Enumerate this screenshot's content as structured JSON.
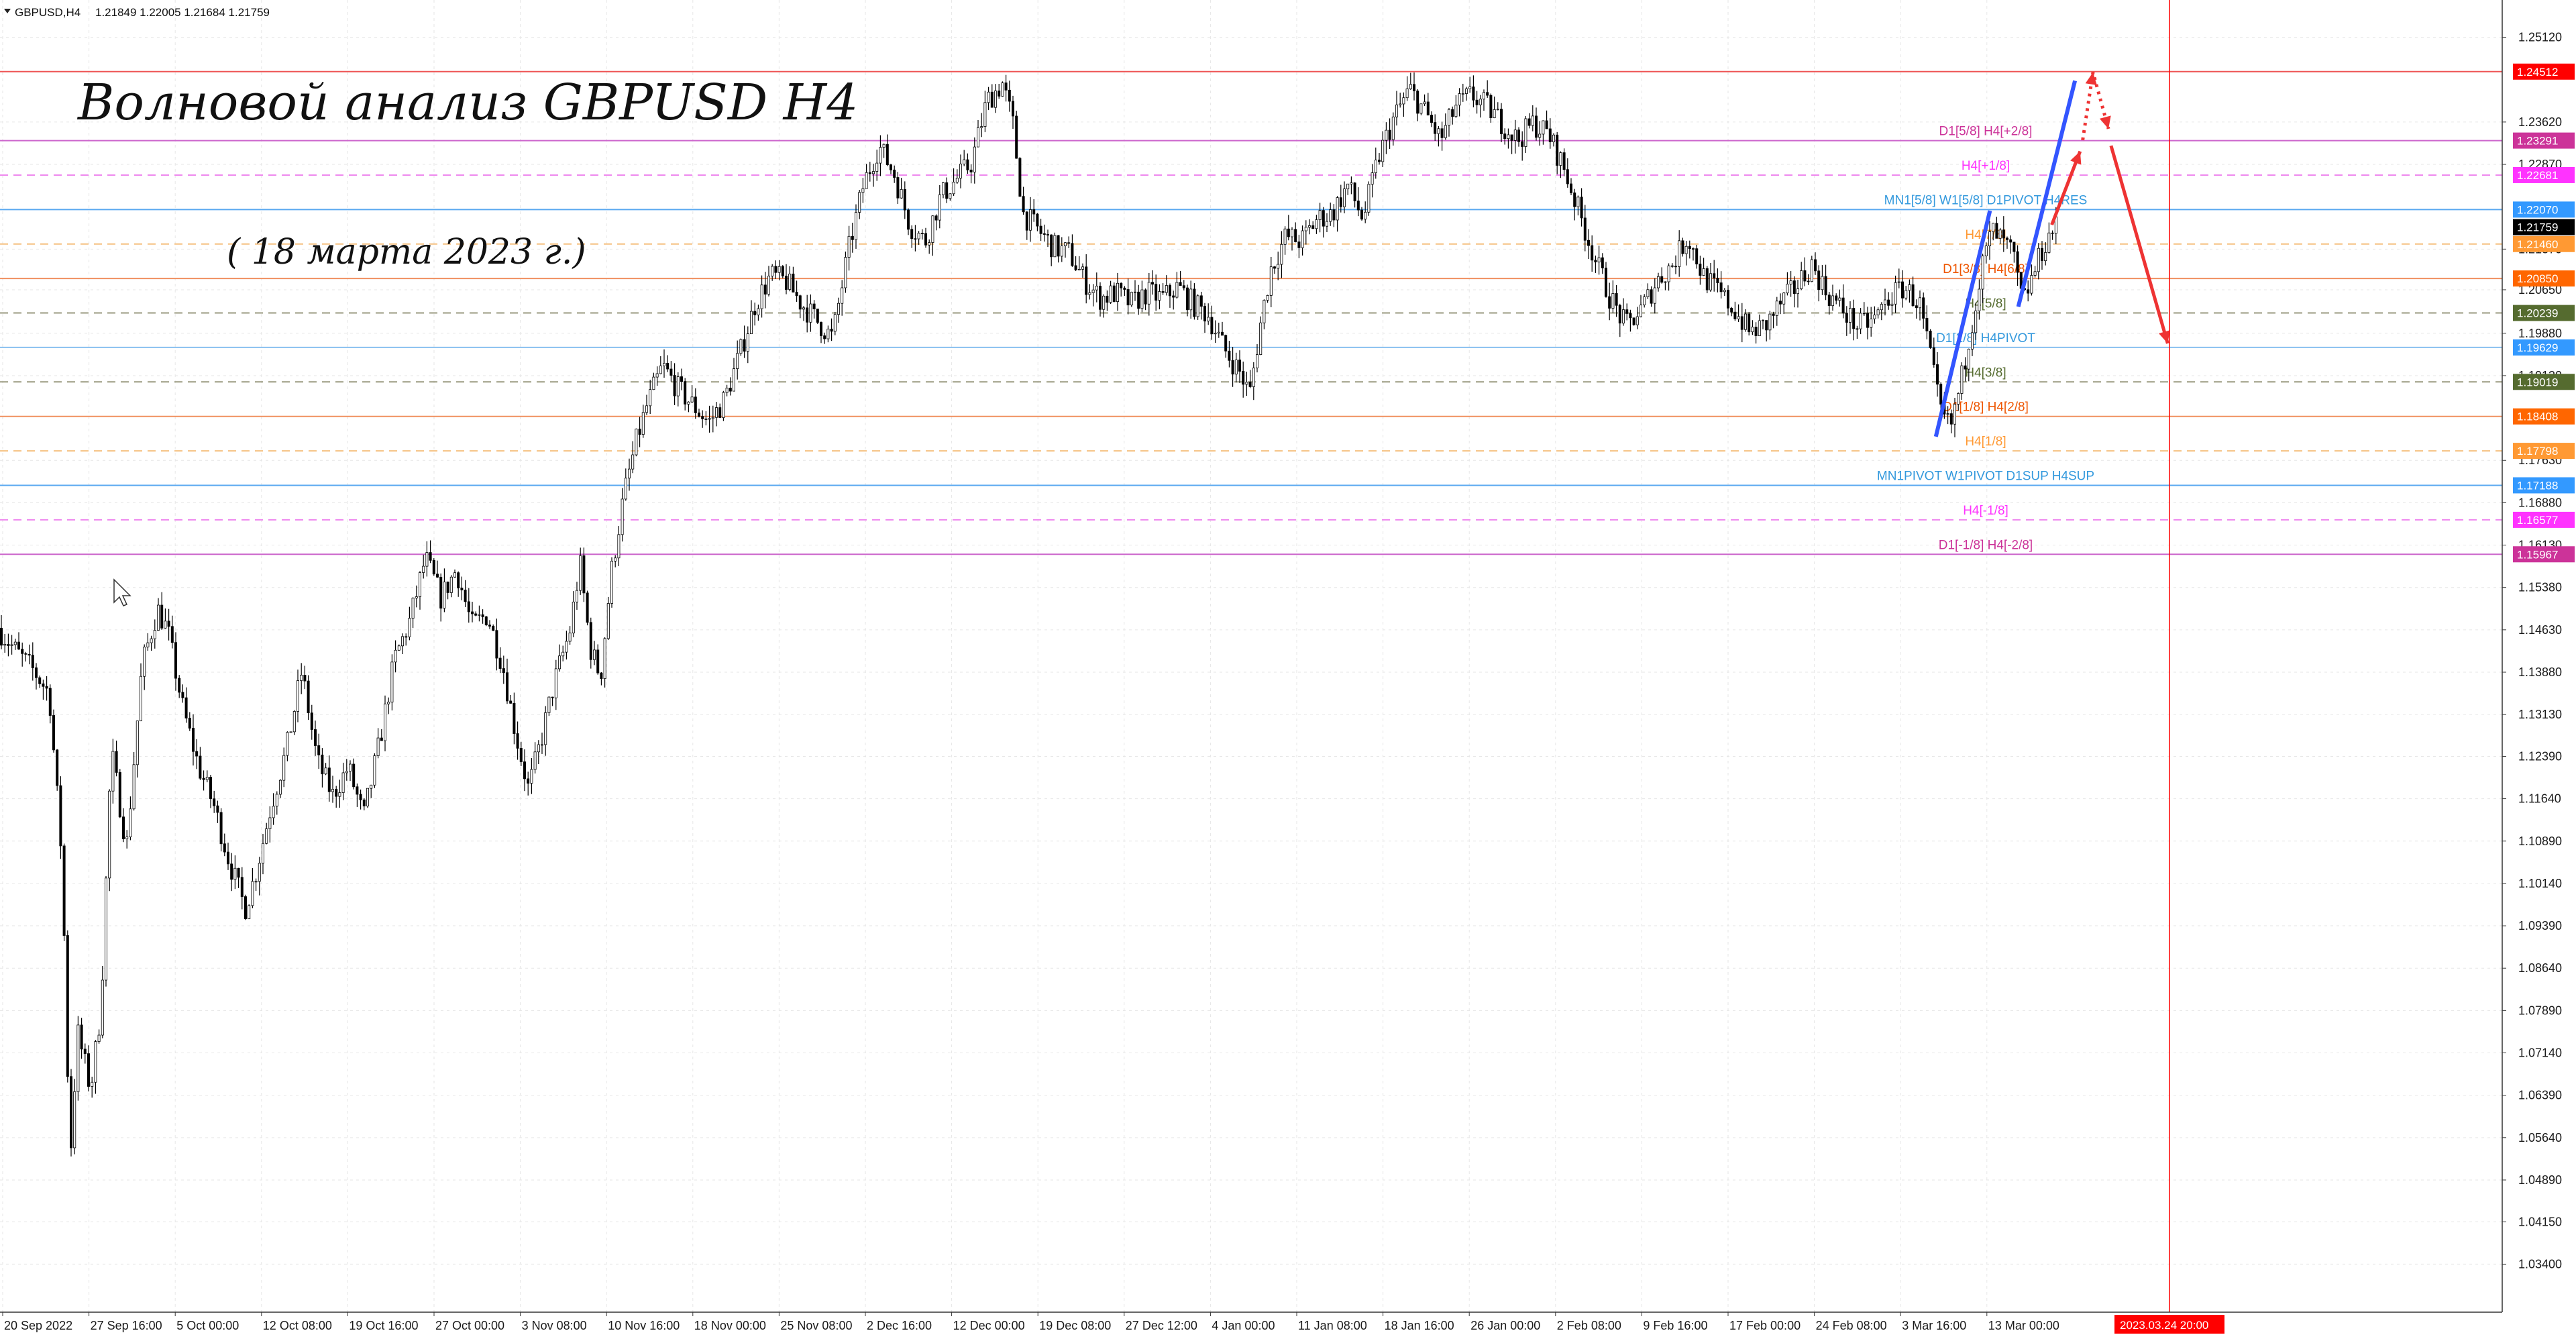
{
  "header": {
    "symbol": "GBPUSD,H4",
    "ohlc": "1.21849 1.22005 1.21684 1.21759"
  },
  "annotations": {
    "title": "Волновой анализ GBPUSD H4",
    "date": "( 18 марта 2023 г.)"
  },
  "price_axis": {
    "min": 1.0255,
    "max": 1.2578,
    "ticks": [
      "1.25120",
      "1.23620",
      "1.22870",
      "1.21370",
      "1.20650",
      "1.19880",
      "1.19130",
      "1.17630",
      "1.16880",
      "1.16130",
      "1.15380",
      "1.14630",
      "1.13880",
      "1.13130",
      "1.12390",
      "1.11640",
      "1.10890",
      "1.10140",
      "1.09390",
      "1.08640",
      "1.07890",
      "1.07140",
      "1.06390",
      "1.05640",
      "1.04890",
      "1.04150",
      "1.03400"
    ]
  },
  "time_axis": {
    "labels": [
      "20 Sep 2022",
      "27 Sep 16:00",
      "5 Oct 00:00",
      "12 Oct 08:00",
      "19 Oct 16:00",
      "27 Oct 00:00",
      "3 Nov 08:00",
      "10 Nov 16:00",
      "18 Nov 00:00",
      "25 Nov 08:00",
      "2 Dec 16:00",
      "12 Dec 00:00",
      "19 Dec 08:00",
      "27 Dec 12:00",
      "4 Jan 00:00",
      "11 Jan 08:00",
      "18 Jan 16:00",
      "26 Jan 00:00",
      "2 Feb 08:00",
      "9 Feb 16:00",
      "17 Feb 00:00",
      "24 Feb 08:00",
      "3 Mar 16:00",
      "13 Mar 00:00"
    ],
    "marker_label": "2023.03.24 20:00"
  },
  "levels": [
    {
      "price": 1.24512,
      "tag": "1.24512",
      "tag_color": "#ff0000",
      "line_color": "#ee5555",
      "style": "solid",
      "label": ""
    },
    {
      "price": 1.23291,
      "tag": "1.23291",
      "tag_color": "#cc3399",
      "line_color": "#cc66cc",
      "style": "solid",
      "label": "D1[5/8] H4[+2/8]",
      "label_color": "#cc3399"
    },
    {
      "price": 1.22681,
      "tag": "1.22681",
      "tag_color": "#ff33ff",
      "line_color": "#ee88ee",
      "style": "dash",
      "label": "H4[+1/8]",
      "label_color": "#ff33ff"
    },
    {
      "price": 1.2207,
      "tag": "1.22070",
      "tag_color": "#3399ff",
      "line_color": "#5aa8f0",
      "style": "solid",
      "label": "MN1[5/8] W1[5/8] D1PIVOT H4RES",
      "label_color": "#3399dd"
    },
    {
      "price": 1.2146,
      "tag": "1.21460",
      "tag_color": "#ff9933",
      "line_color": "#f5c080",
      "style": "dash",
      "label": "H4[7/8]",
      "label_color": "#ff9933"
    },
    {
      "price": 1.2085,
      "tag": "1.20850",
      "tag_color": "#ff6600",
      "line_color": "#f09060",
      "style": "solid",
      "label": "D1[3/8] H4[6/8]",
      "label_color": "#ee5500"
    },
    {
      "price": 1.20239,
      "tag": "1.20239",
      "tag_color": "#556b2f",
      "line_color": "#9a9a80",
      "style": "dash",
      "label": "H4[5/8]",
      "label_color": "#556b2f"
    },
    {
      "price": 1.19629,
      "tag": "1.19629",
      "tag_color": "#3399ff",
      "line_color": "#88c0f0",
      "style": "solid",
      "label": "D1[2/8] H4PIVOT",
      "label_color": "#3399dd"
    },
    {
      "price": 1.19019,
      "tag": "1.19019",
      "tag_color": "#556b2f",
      "line_color": "#9a9a80",
      "style": "dash",
      "label": "H4[3/8]",
      "label_color": "#556b2f"
    },
    {
      "price": 1.18408,
      "tag": "1.18408",
      "tag_color": "#ff6600",
      "line_color": "#f09060",
      "style": "solid",
      "label": "D1[1/8] H4[2/8]",
      "label_color": "#ee5500"
    },
    {
      "price": 1.17798,
      "tag": "1.17798",
      "tag_color": "#ff9933",
      "line_color": "#f5c080",
      "style": "dash",
      "label": "H4[1/8]",
      "label_color": "#ff9933"
    },
    {
      "price": 1.17188,
      "tag": "1.17188",
      "tag_color": "#3399ff",
      "line_color": "#5aa8f0",
      "style": "solid",
      "label": "MN1PIVOT W1PIVOT D1SUP H4SUP",
      "label_color": "#3399dd"
    },
    {
      "price": 1.16577,
      "tag": "1.16577",
      "tag_color": "#ff33ff",
      "line_color": "#ee88ee",
      "style": "dash",
      "label": "H4[-1/8]",
      "label_color": "#ff33ff"
    },
    {
      "price": 1.15967,
      "tag": "1.15967",
      "tag_color": "#cc3399",
      "line_color": "#cc66cc",
      "style": "solid",
      "label": "D1[-1/8] H4[-2/8]",
      "label_color": "#cc3399"
    }
  ],
  "current_price": {
    "price": 1.21759,
    "tag": "1.21759"
  },
  "chart_data": {
    "type": "candlestick",
    "series_path": [
      [
        0.0,
        1.1466
      ],
      [
        0.008,
        1.142
      ],
      [
        0.014,
        1.139
      ],
      [
        0.02,
        1.135
      ],
      [
        0.025,
        1.105
      ],
      [
        0.028,
        1.052
      ],
      [
        0.031,
        1.075
      ],
      [
        0.036,
        1.065
      ],
      [
        0.04,
        1.079
      ],
      [
        0.044,
        1.125
      ],
      [
        0.05,
        1.108
      ],
      [
        0.056,
        1.14
      ],
      [
        0.062,
        1.15
      ],
      [
        0.066,
        1.146
      ],
      [
        0.072,
        1.132
      ],
      [
        0.078,
        1.122
      ],
      [
        0.084,
        1.115
      ],
      [
        0.09,
        1.105
      ],
      [
        0.096,
        1.097
      ],
      [
        0.1,
        1.103
      ],
      [
        0.106,
        1.115
      ],
      [
        0.112,
        1.125
      ],
      [
        0.118,
        1.139
      ],
      [
        0.124,
        1.123
      ],
      [
        0.13,
        1.117
      ],
      [
        0.136,
        1.122
      ],
      [
        0.142,
        1.113
      ],
      [
        0.148,
        1.126
      ],
      [
        0.154,
        1.141
      ],
      [
        0.16,
        1.148
      ],
      [
        0.166,
        1.159
      ],
      [
        0.172,
        1.152
      ],
      [
        0.178,
        1.157
      ],
      [
        0.184,
        1.147
      ],
      [
        0.19,
        1.149
      ],
      [
        0.196,
        1.14
      ],
      [
        0.201,
        1.128
      ],
      [
        0.206,
        1.118
      ],
      [
        0.211,
        1.127
      ],
      [
        0.216,
        1.137
      ],
      [
        0.222,
        1.146
      ],
      [
        0.226,
        1.158
      ],
      [
        0.23,
        1.143
      ],
      [
        0.234,
        1.138
      ],
      [
        0.238,
        1.156
      ],
      [
        0.243,
        1.17
      ],
      [
        0.248,
        1.18
      ],
      [
        0.252,
        1.186
      ],
      [
        0.258,
        1.193
      ],
      [
        0.264,
        1.189
      ],
      [
        0.27,
        1.186
      ],
      [
        0.276,
        1.183
      ],
      [
        0.282,
        1.187
      ],
      [
        0.288,
        1.195
      ],
      [
        0.294,
        1.204
      ],
      [
        0.3,
        1.209
      ],
      [
        0.306,
        1.208
      ],
      [
        0.312,
        1.204
      ],
      [
        0.318,
        1.201
      ],
      [
        0.324,
        1.198
      ],
      [
        0.33,
        1.213
      ],
      [
        0.336,
        1.225
      ],
      [
        0.342,
        1.232
      ],
      [
        0.348,
        1.227
      ],
      [
        0.354,
        1.218
      ],
      [
        0.36,
        1.215
      ],
      [
        0.366,
        1.223
      ],
      [
        0.372,
        1.226
      ],
      [
        0.378,
        1.229
      ],
      [
        0.384,
        1.24
      ],
      [
        0.39,
        1.243
      ],
      [
        0.394,
        1.236
      ],
      [
        0.398,
        1.22
      ],
      [
        0.404,
        1.217
      ],
      [
        0.41,
        1.214
      ],
      [
        0.416,
        1.213
      ],
      [
        0.422,
        1.208
      ],
      [
        0.428,
        1.205
      ],
      [
        0.434,
        1.206
      ],
      [
        0.44,
        1.204
      ],
      [
        0.446,
        1.206
      ],
      [
        0.452,
        1.205
      ],
      [
        0.458,
        1.207
      ],
      [
        0.464,
        1.204
      ],
      [
        0.47,
        1.202
      ],
      [
        0.476,
        1.196
      ],
      [
        0.482,
        1.192
      ],
      [
        0.486,
        1.188
      ],
      [
        0.49,
        1.2
      ],
      [
        0.494,
        1.21
      ],
      [
        0.5,
        1.216
      ],
      [
        0.506,
        1.215
      ],
      [
        0.512,
        1.219
      ],
      [
        0.518,
        1.22
      ],
      [
        0.524,
        1.225
      ],
      [
        0.53,
        1.219
      ],
      [
        0.536,
        1.23
      ],
      [
        0.542,
        1.237
      ],
      [
        0.548,
        1.242
      ],
      [
        0.554,
        1.238
      ],
      [
        0.56,
        1.233
      ],
      [
        0.566,
        1.239
      ],
      [
        0.572,
        1.241
      ],
      [
        0.578,
        1.239
      ],
      [
        0.584,
        1.236
      ],
      [
        0.59,
        1.233
      ],
      [
        0.596,
        1.236
      ],
      [
        0.602,
        1.234
      ],
      [
        0.608,
        1.228
      ],
      [
        0.614,
        1.22
      ],
      [
        0.62,
        1.212
      ],
      [
        0.626,
        1.205
      ],
      [
        0.632,
        1.2
      ],
      [
        0.638,
        1.203
      ],
      [
        0.644,
        1.208
      ],
      [
        0.65,
        1.211
      ],
      [
        0.656,
        1.216
      ],
      [
        0.662,
        1.209
      ],
      [
        0.668,
        1.206
      ],
      [
        0.674,
        1.203
      ],
      [
        0.68,
        1.199
      ],
      [
        0.686,
        1.2
      ],
      [
        0.692,
        1.204
      ],
      [
        0.698,
        1.207
      ],
      [
        0.704,
        1.211
      ],
      [
        0.71,
        1.206
      ],
      [
        0.716,
        1.203
      ],
      [
        0.722,
        1.2
      ],
      [
        0.728,
        1.201
      ],
      [
        0.734,
        1.205
      ],
      [
        0.74,
        1.207
      ],
      [
        0.746,
        1.204
      ],
      [
        0.75,
        1.195
      ],
      [
        0.754,
        1.185
      ],
      [
        0.758,
        1.182
      ],
      [
        0.762,
        1.19
      ],
      [
        0.766,
        1.2
      ],
      [
        0.77,
        1.21
      ],
      [
        0.774,
        1.217
      ],
      [
        0.778,
        1.215
      ],
      [
        0.782,
        1.213
      ],
      [
        0.786,
        1.204
      ],
      [
        0.79,
        1.209
      ],
      [
        0.794,
        1.214
      ],
      [
        0.798,
        1.2176
      ]
    ]
  },
  "forecast": {
    "blue_lines": [
      [
        [
          0.7515,
          1.1805
        ],
        [
          0.7725,
          1.2205
        ]
      ],
      [
        [
          0.7835,
          1.2035
        ],
        [
          0.8055,
          1.2435
        ]
      ]
    ],
    "red_path": [
      [
        0.7965,
        1.218
      ],
      [
        0.8075,
        1.231
      ]
    ],
    "red_dotted": [
      [
        0.8085,
        1.233
      ],
      [
        0.8125,
        1.245
      ],
      [
        0.8185,
        1.235
      ]
    ],
    "red_down": [
      [
        0.8195,
        1.232
      ],
      [
        0.8415,
        1.197
      ]
    ]
  },
  "colors": {
    "bull": "#ffffff",
    "bear": "#000000",
    "grid": "#e6e6e6",
    "forecast_blue": "#3355ff",
    "forecast_red": "#ee3333",
    "time_marker": "#ff0000"
  }
}
